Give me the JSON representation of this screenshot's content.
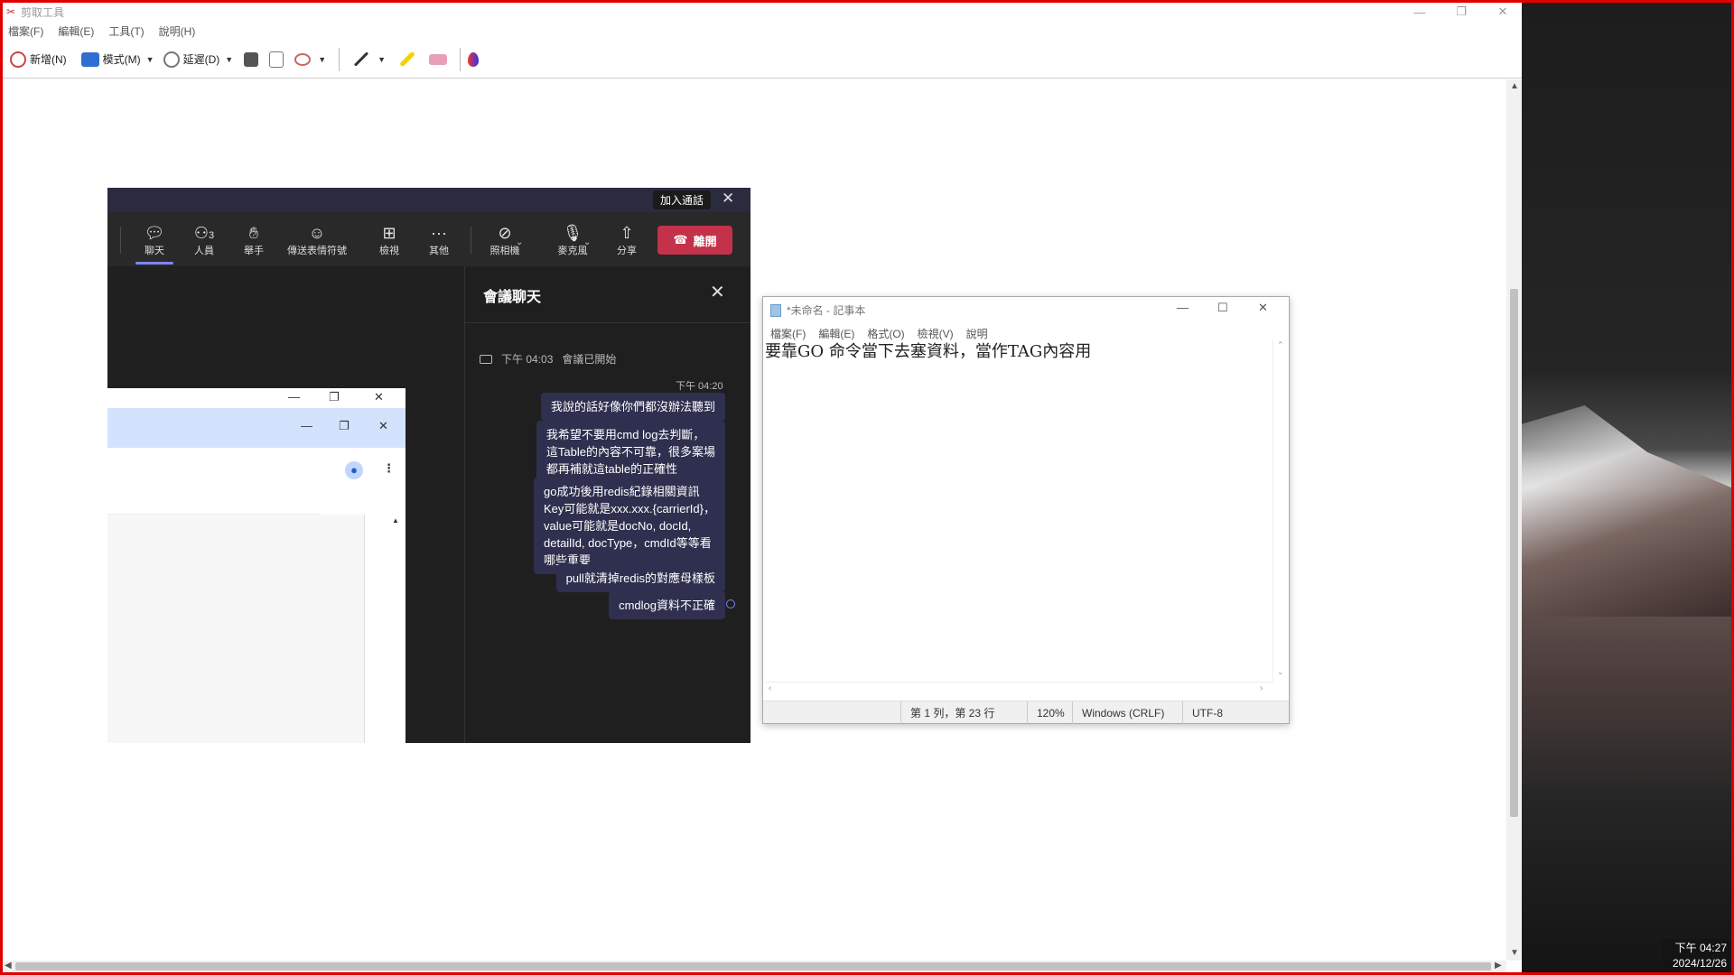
{
  "snip": {
    "title": "剪取工具",
    "menu": [
      "檔案(F)",
      "編輯(E)",
      "工具(T)",
      "說明(H)"
    ],
    "toolbar": {
      "new": "新增(N)",
      "mode": "模式(M)",
      "delay": "延遲(D)"
    },
    "colors": {
      "frame": "#e10000"
    }
  },
  "teams": {
    "join_label": "加入通話",
    "buttons": [
      {
        "label": "聊天",
        "icon": "chat-icon"
      },
      {
        "label": "人員",
        "icon": "people-icon",
        "count": "3"
      },
      {
        "label": "舉手",
        "icon": "raise-hand-icon"
      },
      {
        "label": "傳送表情符號",
        "icon": "emoji-icon"
      },
      {
        "label": "檢視",
        "icon": "view-grid-icon"
      },
      {
        "label": "其他",
        "icon": "more-icon"
      },
      {
        "label": "照相機",
        "icon": "camera-off-icon"
      },
      {
        "label": "麥克風",
        "icon": "mic-off-icon"
      },
      {
        "label": "分享",
        "icon": "share-icon"
      }
    ],
    "leave_label": "離開",
    "chat": {
      "title": "會議聊天",
      "system_time": "下午 04:03",
      "system_text": "會議已開始",
      "msg_time": "下午 04:20",
      "messages": [
        "我說的話好像你們都沒辦法聽到",
        "我希望不要用cmd log去判斷，\n這Table的內容不可靠，很多案場\n都再補就這table的正確性",
        "go成功後用redis紀錄相關資訊\nKey可能就是xxx.xxx.{carrierId}，\nvalue可能就是docNo, docId,\ndetailId, docType，cmdId等等看\n哪些重要",
        "pull就清掉redis的對應母樣板",
        "cmdlog資料不正確"
      ]
    }
  },
  "notepad": {
    "title": "*未命名 - 記事本",
    "menu": [
      "檔案(F)",
      "編輯(E)",
      "格式(O)",
      "檢視(V)",
      "說明"
    ],
    "content": "要靠GO 命令當下去塞資料，當作TAG內容用",
    "status": {
      "position": "第 1 列，第 23 行",
      "zoom": "120%",
      "eol": "Windows (CRLF)",
      "encoding": "UTF-8"
    }
  },
  "taskbar": {
    "time": "下午 04:27",
    "date": "2024/12/26"
  }
}
